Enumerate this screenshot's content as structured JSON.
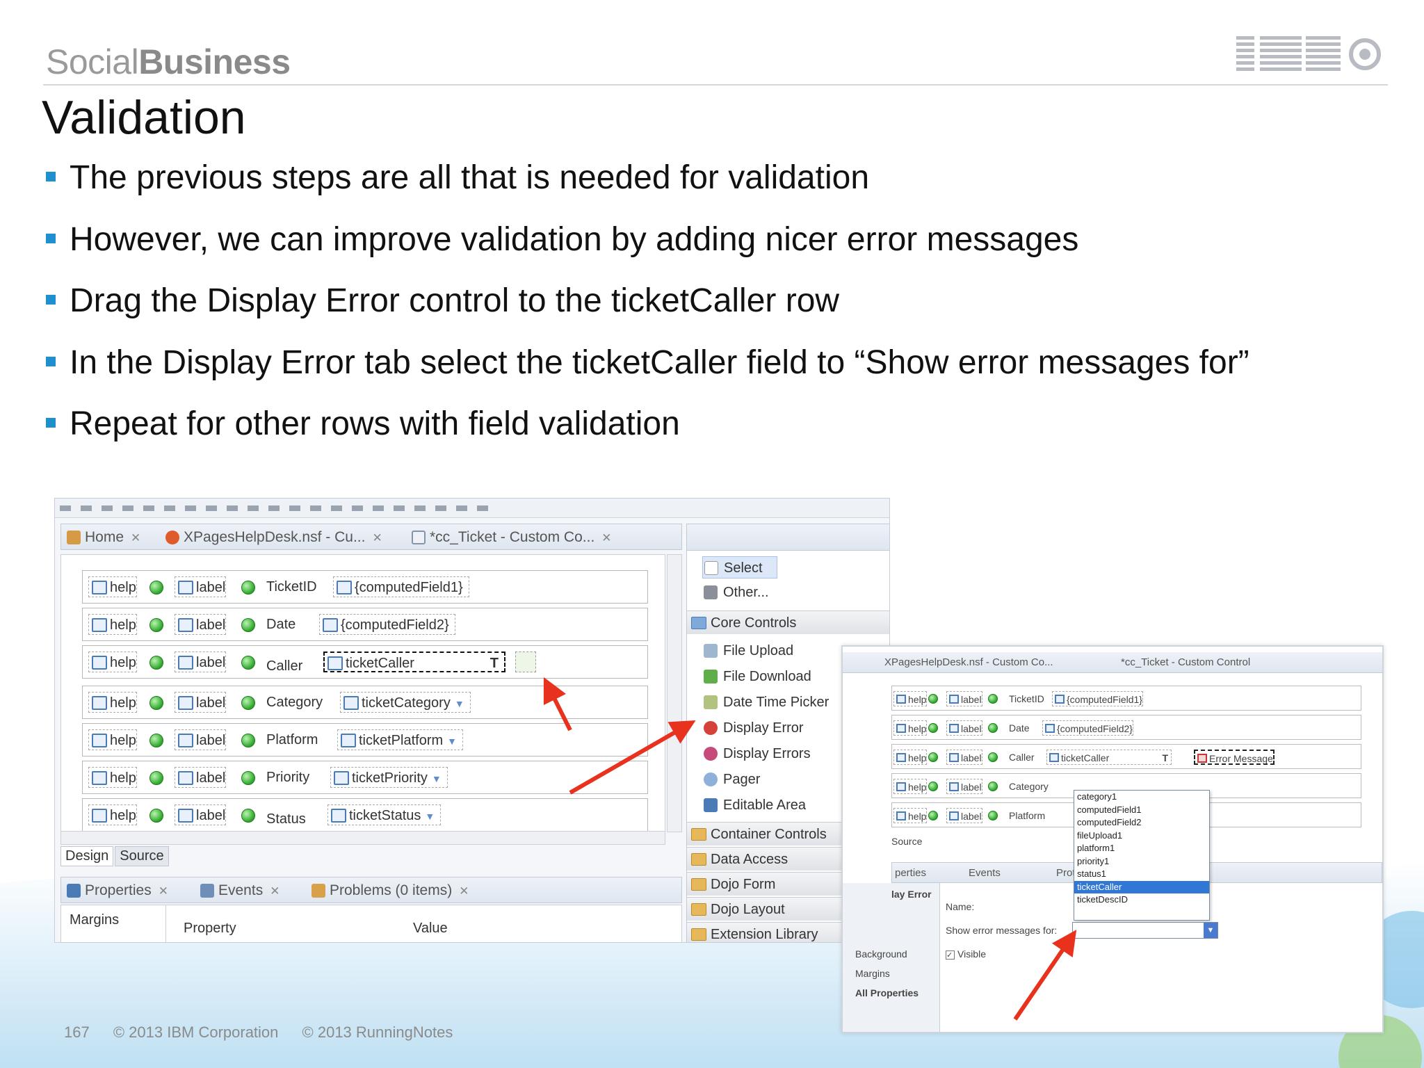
{
  "brand": {
    "light": "Social",
    "bold": "Business"
  },
  "title": "Validation",
  "bullets": [
    "The previous steps are all that is needed for validation",
    "However, we can improve validation by adding nicer error messages",
    "Drag the Display Error control to the ticketCaller row",
    "In the Display Error tab select the ticketCaller field to “Show error messages for”",
    "Repeat for other rows with field validation"
  ],
  "footer": {
    "page": "167",
    "copy1": "© 2013 IBM Corporation",
    "copy2": "© 2013 RunningNotes"
  },
  "colors": {
    "bullet": "#1f8fcf",
    "arrow": "#e8321e",
    "wave": "#c5e3f4"
  },
  "designer": {
    "tabs": [
      "Home",
      "XPagesHelpDesk.nsf - Cu...",
      "*cc_Ticket - Custom Co..."
    ],
    "rows": [
      {
        "help": "help",
        "label": "label",
        "name": "TicketID",
        "field": "{computedField1}"
      },
      {
        "help": "help",
        "label": "label",
        "name": "Date",
        "field": "{computedField2}"
      },
      {
        "help": "help",
        "label": "label",
        "name": "Caller",
        "field": "ticketCaller"
      },
      {
        "help": "help",
        "label": "label",
        "name": "Category",
        "field": "ticketCategory"
      },
      {
        "help": "help",
        "label": "label",
        "name": "Platform",
        "field": "ticketPlatform"
      },
      {
        "help": "help",
        "label": "label",
        "name": "Priority",
        "field": "ticketPriority"
      },
      {
        "help": "help",
        "label": "label",
        "name": "Status",
        "field": "ticketStatus"
      }
    ],
    "view_tabs": [
      "Design",
      "Source"
    ],
    "prop_tabs": [
      "Properties",
      "Events",
      "Problems (0 items)"
    ],
    "prop_grid": {
      "side": "Margins",
      "col1": "Property",
      "col2": "Value"
    }
  },
  "palette": {
    "top": [
      "Select",
      "Other..."
    ],
    "core_header": "Core Controls",
    "core": [
      "File Upload",
      "File Download",
      "Date Time Picker",
      "Display Error",
      "Display Errors",
      "Pager",
      "Editable Area"
    ],
    "cats": [
      "Container Controls",
      "Data Access",
      "Dojo Form",
      "Dojo Layout",
      "Extension Library"
    ]
  },
  "result": {
    "tabs": [
      "XPagesHelpDesk.nsf - Custom Co...",
      "*cc_Ticket - Custom Control"
    ],
    "rows": [
      {
        "help": "help",
        "label": "label",
        "name": "TicketID",
        "field": "{computedField1}"
      },
      {
        "help": "help",
        "label": "label",
        "name": "Date",
        "field": "{computedField2}"
      },
      {
        "help": "help",
        "label": "label",
        "name": "Caller",
        "field": "ticketCaller",
        "error": "Error Message"
      },
      {
        "help": "help",
        "label": "label",
        "name": "Category",
        "field": ""
      },
      {
        "help": "help",
        "label": "label",
        "name": "Platform",
        "field": ""
      }
    ],
    "source_tab": "Source",
    "prop_tabs": [
      "perties",
      "Events",
      "Prot"
    ],
    "side": [
      "lay Error",
      "Background",
      "Margins",
      "All Properties"
    ],
    "name_label": "Name:",
    "show_label": "Show error messages for:",
    "visible_label": "Visible",
    "options": [
      "category1",
      "computedField1",
      "computedField2",
      "fileUpload1",
      "platform1",
      "priority1",
      "status1",
      "ticketCaller",
      "ticketDescID"
    ],
    "selected_option": "ticketCaller"
  }
}
